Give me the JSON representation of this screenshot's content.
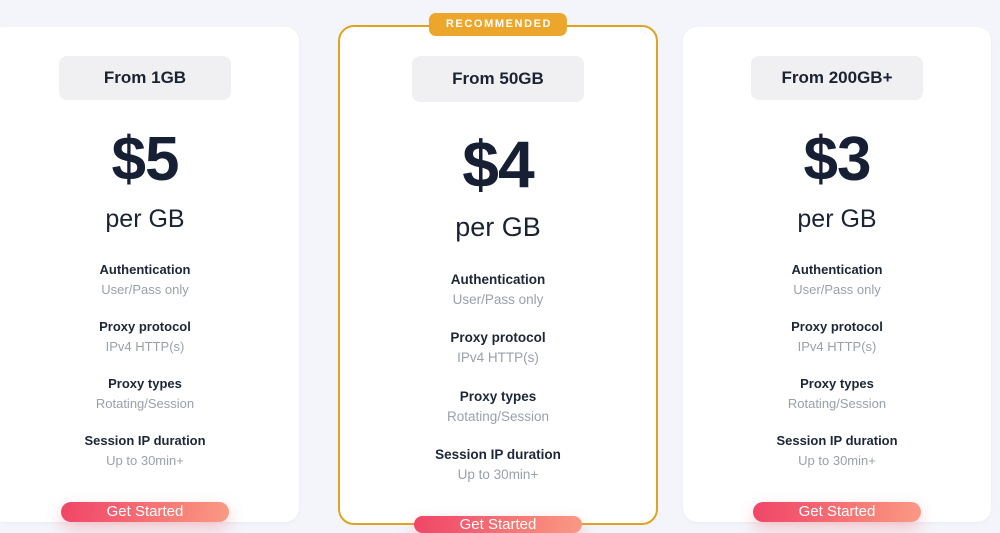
{
  "page": {
    "background_color": "#f3f5fb",
    "accent_gradient_start": "#ef4667",
    "accent_gradient_end": "#fa9a85",
    "featured_border_color": "#dfa322",
    "badge_color": "#eda62c",
    "price_color": "#161f33",
    "muted_text_color": "#9aa0aa"
  },
  "plans": [
    {
      "id": "plan-1gb",
      "tier_label": "From 1GB",
      "price_amount": "$5",
      "price_unit": "per GB",
      "featured": false,
      "badge_label": "",
      "features": [
        {
          "label": "Authentication",
          "value": "User/Pass only"
        },
        {
          "label": "Proxy protocol",
          "value": "IPv4 HTTP(s)"
        },
        {
          "label": "Proxy types",
          "value": "Rotating/Session"
        },
        {
          "label": "Session IP duration",
          "value": "Up to 30min+"
        }
      ],
      "cta_label": "Get Started"
    },
    {
      "id": "plan-50gb",
      "tier_label": "From 50GB",
      "price_amount": "$4",
      "price_unit": "per GB",
      "featured": true,
      "badge_label": "RECOMMENDED",
      "features": [
        {
          "label": "Authentication",
          "value": "User/Pass only"
        },
        {
          "label": "Proxy protocol",
          "value": "IPv4 HTTP(s)"
        },
        {
          "label": "Proxy types",
          "value": "Rotating/Session"
        },
        {
          "label": "Session IP duration",
          "value": "Up to 30min+"
        }
      ],
      "cta_label": "Get Started"
    },
    {
      "id": "plan-200gb",
      "tier_label": "From 200GB+",
      "price_amount": "$3",
      "price_unit": "per GB",
      "featured": false,
      "badge_label": "",
      "features": [
        {
          "label": "Authentication",
          "value": "User/Pass only"
        },
        {
          "label": "Proxy protocol",
          "value": "IPv4 HTTP(s)"
        },
        {
          "label": "Proxy types",
          "value": "Rotating/Session"
        },
        {
          "label": "Session IP duration",
          "value": "Up to 30min+"
        }
      ],
      "cta_label": "Get Started"
    }
  ]
}
